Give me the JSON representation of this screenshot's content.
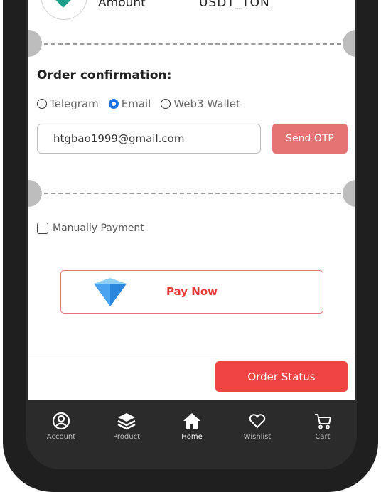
{
  "top_row": {
    "label": "Amount",
    "value": "USDT_TON"
  },
  "order_confirmation": {
    "title": "Order confirmation:",
    "options": [
      {
        "label": "Telegram",
        "selected": false
      },
      {
        "label": "Email",
        "selected": true
      },
      {
        "label": "Web3 Wallet",
        "selected": false
      }
    ],
    "email_value": "htgbao1999@gmail.com",
    "send_otp_label": "Send OTP"
  },
  "manual_payment_label": "Manually Payment",
  "pay_now_label": "Pay Now",
  "order_status_label": "Order Status",
  "bottom_nav": [
    {
      "label": "Account",
      "icon": "account-icon",
      "active": false
    },
    {
      "label": "Product",
      "icon": "product-layers-icon",
      "active": false
    },
    {
      "label": "Home",
      "icon": "home-icon",
      "active": true
    },
    {
      "label": "Wishlist",
      "icon": "heart-icon",
      "active": false
    },
    {
      "label": "Cart",
      "icon": "cart-icon",
      "active": false
    }
  ],
  "colors": {
    "accent_red": "#ef4444",
    "otp_button": "#e57373",
    "radio_selected": "#1a73e8",
    "frame": "#1f1f1f"
  }
}
